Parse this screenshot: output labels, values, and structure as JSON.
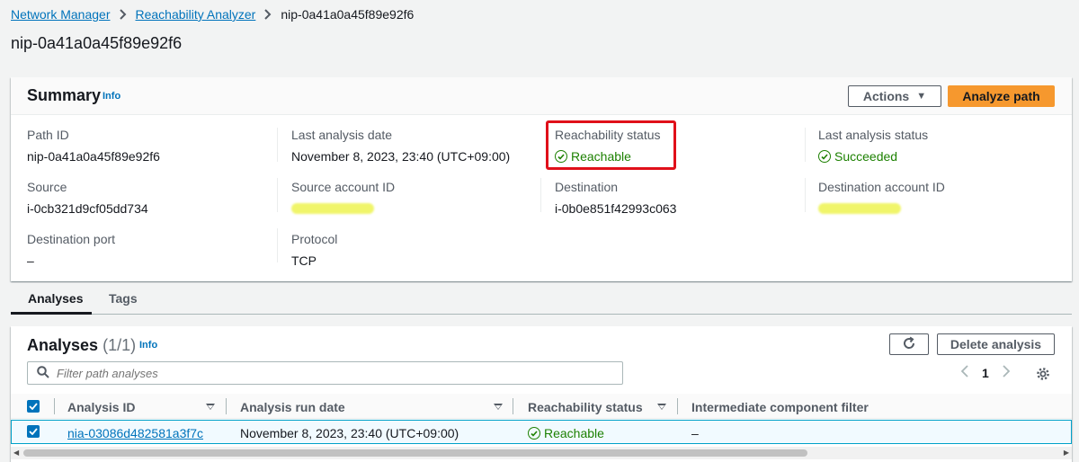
{
  "breadcrumb": {
    "items": [
      "Network Manager",
      "Reachability Analyzer"
    ],
    "current": "nip-0a41a0a45f89e92f6"
  },
  "page_title": "nip-0a41a0a45f89e92f6",
  "summary": {
    "title": "Summary",
    "info": "Info",
    "actions_label": "Actions",
    "analyze_label": "Analyze path",
    "fields": {
      "path_id_label": "Path ID",
      "path_id": "nip-0a41a0a45f89e92f6",
      "last_analysis_date_label": "Last analysis date",
      "last_analysis_date": "November 8, 2023, 23:40 (UTC+09:00)",
      "reachability_status_label": "Reachability status",
      "reachability_status": "Reachable",
      "last_analysis_status_label": "Last analysis status",
      "last_analysis_status": "Succeeded",
      "source_label": "Source",
      "source": "i-0cb321d9cf05dd734",
      "source_account_label": "Source account ID",
      "destination_label": "Destination",
      "destination": "i-0b0e851f42993c063",
      "destination_account_label": "Destination account ID",
      "destination_port_label": "Destination port",
      "destination_port": "–",
      "protocol_label": "Protocol",
      "protocol": "TCP"
    }
  },
  "tabs": [
    {
      "label": "Analyses",
      "active": true
    },
    {
      "label": "Tags",
      "active": false
    }
  ],
  "analyses": {
    "title": "Analyses",
    "count": "(1/1)",
    "info": "Info",
    "delete_label": "Delete analysis",
    "filter_placeholder": "Filter path analyses",
    "page": "1",
    "columns": [
      "Analysis ID",
      "Analysis run date",
      "Reachability status",
      "Intermediate component filter"
    ],
    "rows": [
      {
        "id": "nia-03086d482581a3f7c",
        "run_date": "November 8, 2023, 23:40 (UTC+09:00)",
        "status": "Reachable",
        "filter": "–"
      }
    ]
  },
  "colors": {
    "link": "#0073bb",
    "success": "#1d8102",
    "primary_button": "#f6982e",
    "highlight": "#e0101a"
  }
}
